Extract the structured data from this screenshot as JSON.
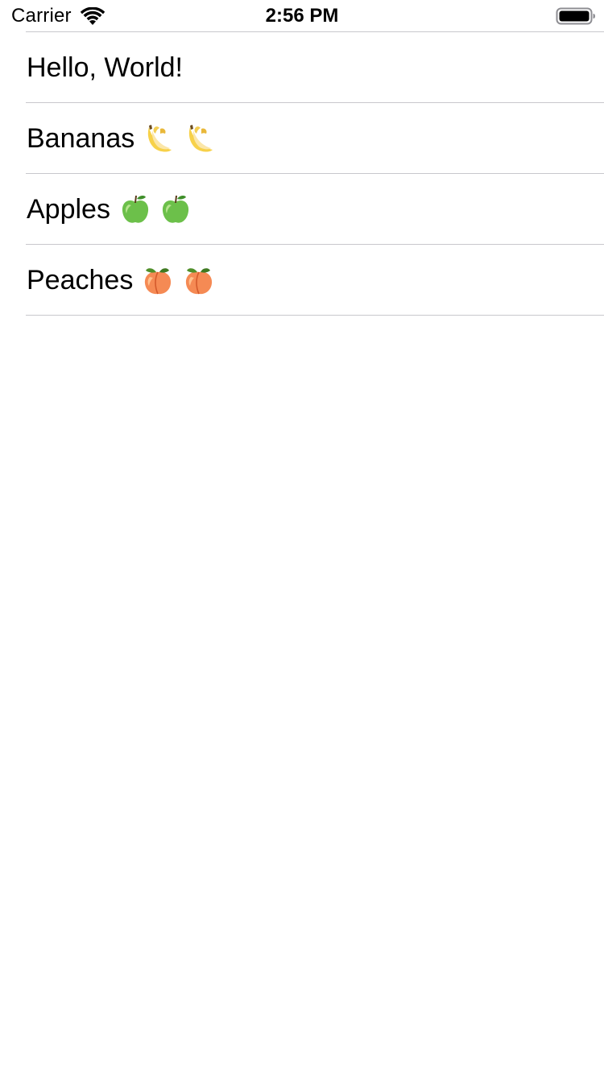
{
  "status_bar": {
    "carrier": "Carrier",
    "time": "2:56 PM",
    "icons": [
      "wifi-icon",
      "battery-icon"
    ]
  },
  "list": {
    "separator_color": "#c8c7cc",
    "rows": [
      {
        "label": "Hello, World!",
        "emoji": []
      },
      {
        "label": "Bananas",
        "emoji": [
          "banana-icon",
          "banana-icon"
        ]
      },
      {
        "label": "Apples",
        "emoji": [
          "green-apple-icon",
          "green-apple-icon"
        ]
      },
      {
        "label": "Peaches",
        "emoji": [
          "peach-icon",
          "peach-icon"
        ]
      }
    ]
  }
}
